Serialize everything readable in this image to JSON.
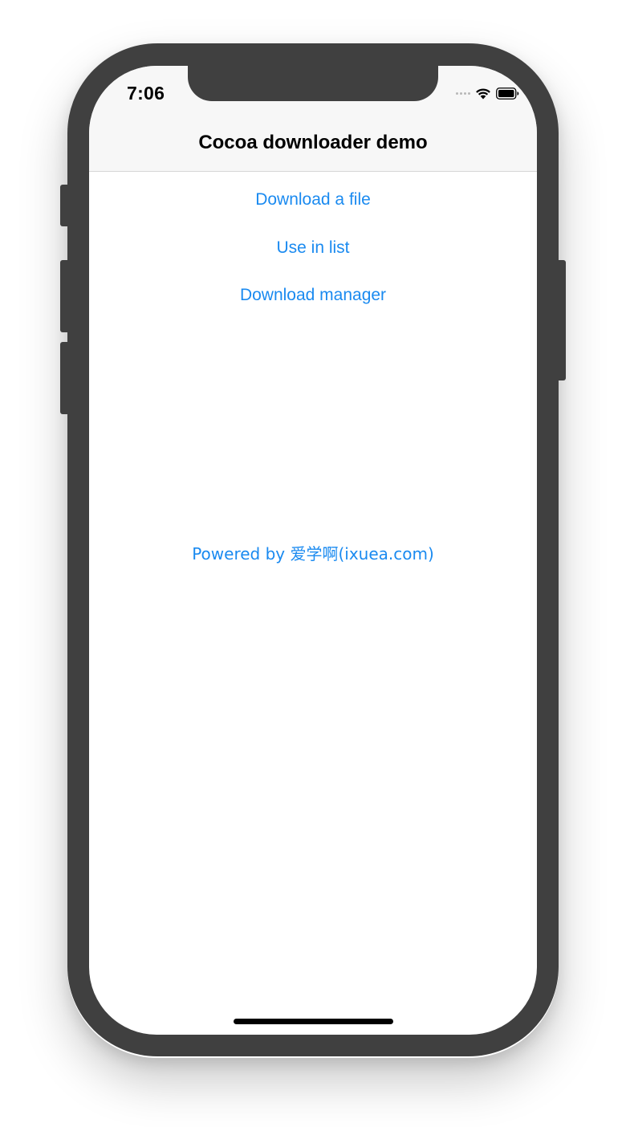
{
  "status_bar": {
    "time": "7:06",
    "icons": [
      "signal-dots-icon",
      "wifi-icon",
      "battery-icon"
    ]
  },
  "navbar": {
    "title": "Cocoa downloader demo"
  },
  "menu": {
    "items": [
      {
        "label": "Download a file"
      },
      {
        "label": "Use in list"
      },
      {
        "label": "Download manager"
      }
    ]
  },
  "footer": {
    "powered_by": "Powered by 爱学啊(ixuea.com)"
  },
  "colors": {
    "link": "#1a8af0",
    "navbar_bg": "#f7f7f7",
    "device_frame": "#404040"
  }
}
